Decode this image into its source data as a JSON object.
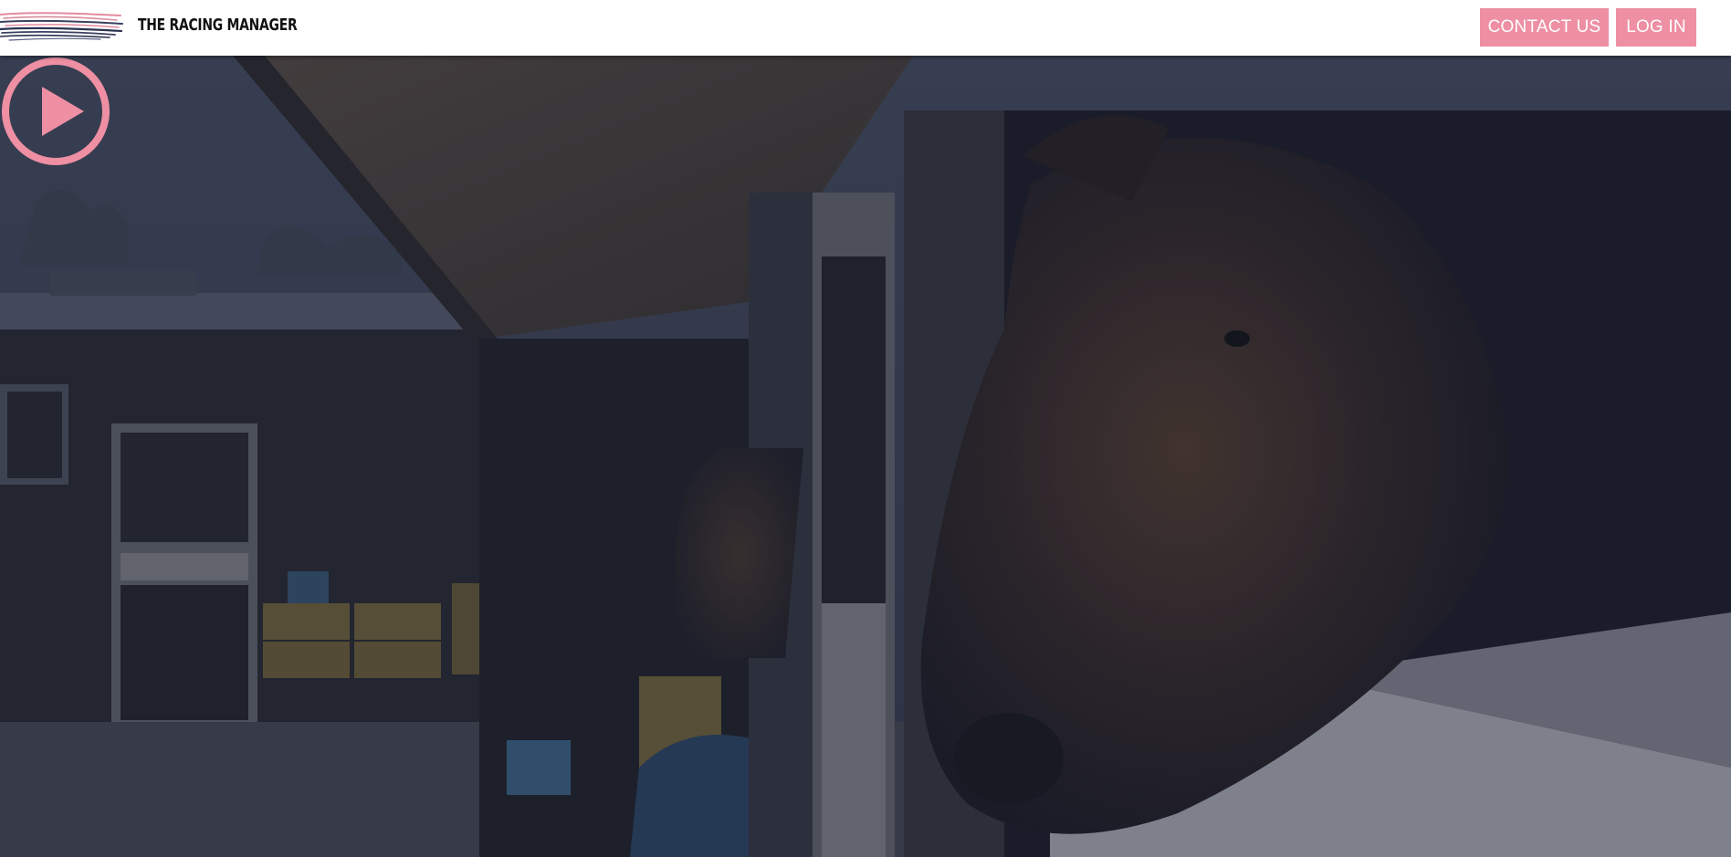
{
  "header": {
    "brand": "THE RACING MANAGER",
    "logo_icon": "brush-stroke-logo-icon",
    "contact_label": "CONTACT US",
    "login_label": "LOG IN"
  },
  "hero": {
    "media": "stable-horses-video",
    "play_icon": "play-icon"
  },
  "colors": {
    "accent": "#ee8fa3",
    "header_bg": "#ffffff",
    "overlay": "#1b2130"
  }
}
